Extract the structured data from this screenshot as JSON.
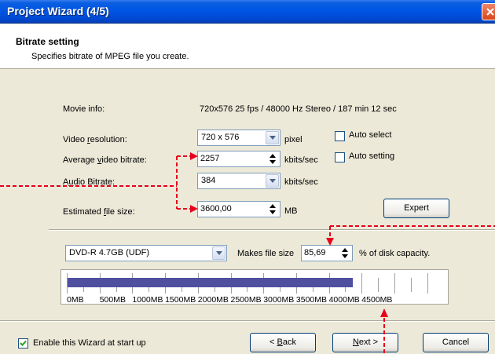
{
  "window": {
    "title": "Project Wizard (4/5)"
  },
  "header": {
    "title": "Bitrate setting",
    "subtitle": "Specifies bitrate of MPEG file you create."
  },
  "movie_info": {
    "label": "Movie info:",
    "value": "720x576 25 fps / 48000 Hz Stereo / 187 min 12 sec"
  },
  "video_resolution": {
    "label_pre": "Video ",
    "label_u": "r",
    "label_post": "esolution:",
    "value": "720 x 576",
    "unit": "pixel"
  },
  "auto_select": {
    "label": "Auto select",
    "checked": false
  },
  "avg_bitrate": {
    "label_pre": "Average ",
    "label_u": "v",
    "label_post": "ideo bitrate:",
    "value": "2257",
    "unit": "kbits/sec"
  },
  "auto_setting": {
    "label": "Auto setting",
    "checked": false
  },
  "audio_bitrate": {
    "label_pre": "A",
    "label_u": "u",
    "label_post": "dio Bitrate:",
    "value": "384",
    "unit": "kbits/sec"
  },
  "file_size": {
    "label_pre": "Estimated ",
    "label_u": "f",
    "label_post": "ile size:",
    "value": "3600,00",
    "unit": "MB"
  },
  "expert_button": "Expert",
  "disk": {
    "selected": "DVD-R 4.7GB (UDF)",
    "makes_label": "Makes file size",
    "percent": "85,69",
    "percent_suffix": "% of disk capacity.",
    "fill_fraction": 0.7658,
    "scale_labels": [
      "0MB",
      "500MB",
      "1000MB",
      "1500MB",
      "2000MB",
      "2500MB",
      "3000MB",
      "3500MB",
      "4000MB",
      "4500MB"
    ]
  },
  "footer": {
    "enable_label": "Enable this Wizard at start up",
    "enable_checked": true,
    "back_pre": "< ",
    "back_u": "B",
    "back_post": "ack",
    "next_u": "N",
    "next_post": "ext >",
    "cancel": "Cancel"
  },
  "colors": {
    "annotation": "#e8001c",
    "bar_fill": "#4f4fa0",
    "title_bar": "#0055e5"
  }
}
